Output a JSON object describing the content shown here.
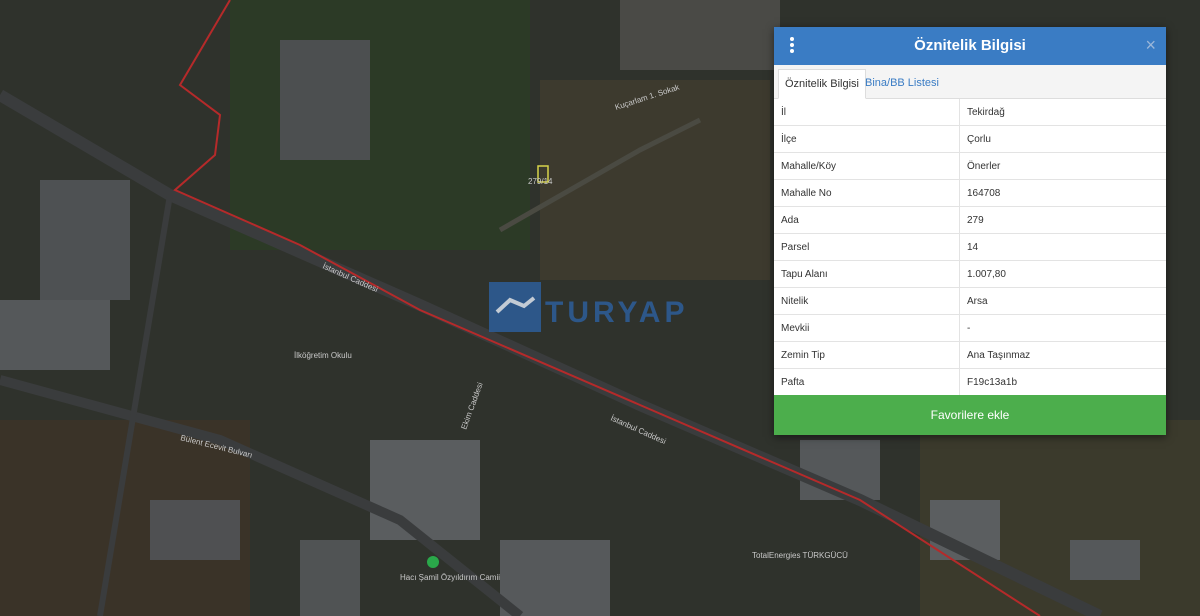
{
  "map": {
    "parcel_label": "279/14",
    "watermark": "TURYAP",
    "street_labels": {
      "istanbul_caddesi": "İstanbul Caddesi",
      "bulent_ecevit": "Bülent Ecevit Bulvarı",
      "ilkogretim": "İlköğretim Okulu",
      "mosque": "Hacı Şamil Özyıldırım Camii",
      "turkgucu": "TotalEnergies TÜRKGÜCÜ",
      "kucarlam": "Kuçarlam 1. Sokak",
      "elcim": "Ekim Caddesi"
    }
  },
  "panel": {
    "title": "Öznitelik Bilgisi",
    "tabs": [
      "Öznitelik Bilgisi",
      "Bina/BB Listesi"
    ],
    "rows": [
      {
        "key": "İl",
        "value": "Tekirdağ"
      },
      {
        "key": "İlçe",
        "value": "Çorlu"
      },
      {
        "key": "Mahalle/Köy",
        "value": "Önerler"
      },
      {
        "key": "Mahalle No",
        "value": "164708"
      },
      {
        "key": "Ada",
        "value": "279"
      },
      {
        "key": "Parsel",
        "value": "14"
      },
      {
        "key": "Tapu Alanı",
        "value": "1.007,80"
      },
      {
        "key": "Nitelik",
        "value": "Arsa"
      },
      {
        "key": "Mevkii",
        "value": "-"
      },
      {
        "key": "Zemin Tip",
        "value": "Ana Taşınmaz"
      },
      {
        "key": "Pafta",
        "value": "F19c13a1b"
      }
    ],
    "favorite_button": "Favorilere ekle",
    "close_symbol": "×"
  },
  "colors": {
    "header": "#3a7cc4",
    "button": "#4cae4c",
    "boundary": "#b52a2a",
    "parcel": "#d8d34a"
  }
}
